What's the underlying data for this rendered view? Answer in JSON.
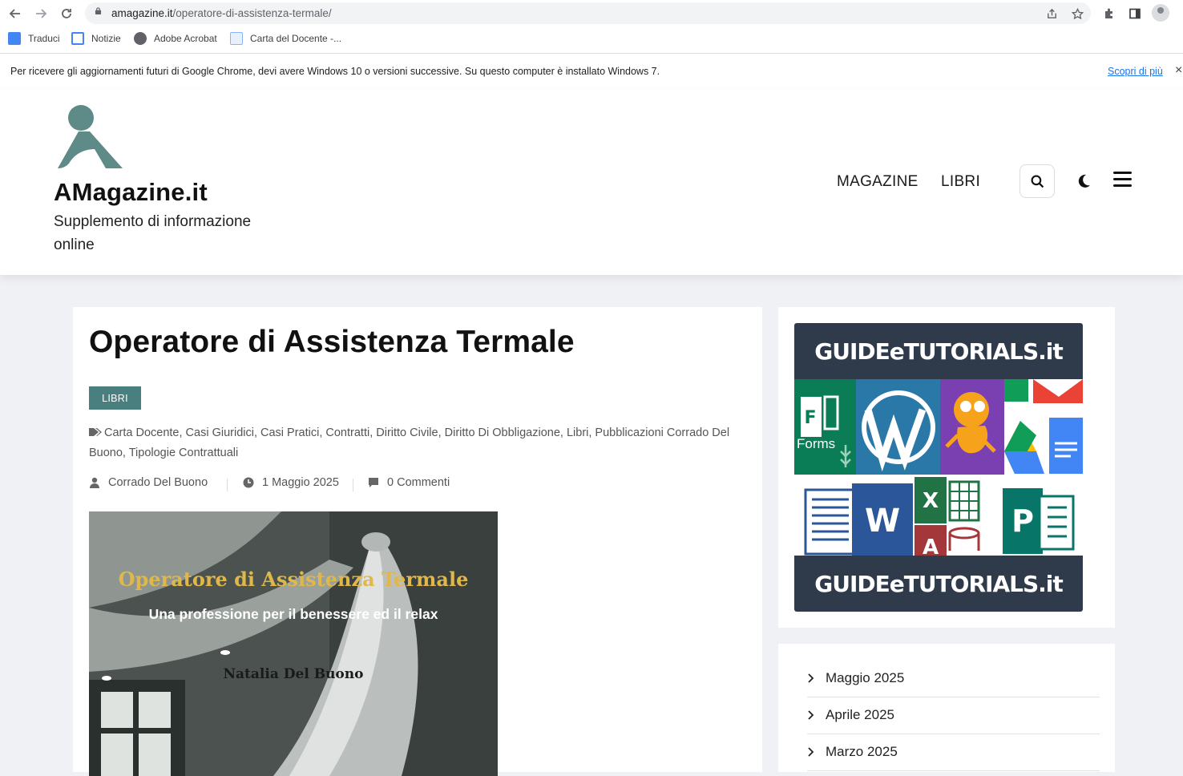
{
  "browser": {
    "url_host": "amagazine.it",
    "url_path": "/operatore-di-assistenza-termale/",
    "bookmarks": [
      {
        "label": "Traduci",
        "icon": "google-translate-icon"
      },
      {
        "label": "Notizie",
        "icon": "google-news-icon"
      },
      {
        "label": "Adobe Acrobat",
        "icon": "globe-icon"
      },
      {
        "label": "Carta del Docente -...",
        "icon": "page-icon"
      }
    ],
    "infobar": {
      "message": "Per ricevere gli aggiornamenti futuri di Google Chrome, devi avere Windows 10 o versioni successive. Su questo computer è installato Windows 7.",
      "link": "Scopri di più",
      "close": "×"
    }
  },
  "site": {
    "title": "AMagazine.it",
    "tagline": "Supplemento di informazione online",
    "menu": [
      "MAGAZINE",
      "LIBRI"
    ],
    "colors": {
      "accent": "#4a7f7f",
      "logo": "#5e8a87"
    }
  },
  "article": {
    "title": "Operatore di Assistenza Termale",
    "category": "LIBRI",
    "tags": [
      "Carta Docente",
      "Casi Giuridici",
      "Casi Pratici",
      "Contratti",
      "Diritto Civile",
      "Diritto Di Obbligazione",
      "Libri",
      "Pubblicazioni Corrado Del Buono",
      "Tipologie Contrattuali"
    ],
    "tags_text": "Carta Docente, Casi Giuridici, Casi Pratici, Contratti, Diritto Civile, Diritto Di Obbligazione, Libri, Pubblicazioni Corrado Del Buono, Tipologie Contrattuali",
    "author": "Corrado Del Buono",
    "date": "1 Maggio 2025",
    "comments": "0 Commenti",
    "cover": {
      "title": "Operatore di Assistenza Termale",
      "subtitle": "Una professione per il benessere ed il relax",
      "author": "Natalia Del Buono"
    }
  },
  "sidebar": {
    "ad": {
      "brand_top": "GUIDEeTUTORIALS.it",
      "brand_bottom": "GUIDEeTUTORIALS.it",
      "forms_label": "Forms"
    },
    "archives": [
      "Maggio 2025",
      "Aprile 2025",
      "Marzo 2025"
    ]
  }
}
